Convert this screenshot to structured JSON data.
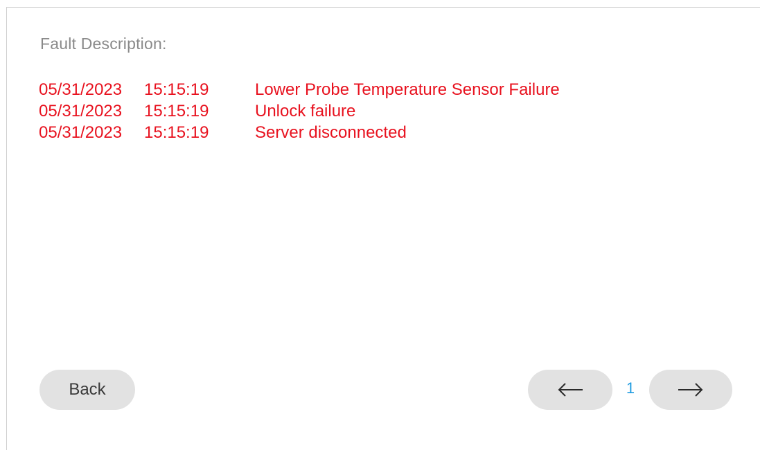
{
  "heading": "Fault Description:",
  "faults": [
    {
      "date": "05/31/2023",
      "time": "15:15:19",
      "description": "Lower Probe Temperature Sensor Failure"
    },
    {
      "date": "05/31/2023",
      "time": "15:15:19",
      "description": "Unlock failure"
    },
    {
      "date": "05/31/2023",
      "time": "15:15:19",
      "description": "Server disconnected"
    }
  ],
  "buttons": {
    "back_label": "Back",
    "prev_icon": "arrow-left-icon",
    "next_icon": "arrow-right-icon"
  },
  "pagination": {
    "current_page": "1"
  },
  "colors": {
    "fault_text": "#e8121f",
    "heading_text": "#8a8a8a",
    "button_bg": "#e2e2e2",
    "page_number": "#1e9be0"
  }
}
